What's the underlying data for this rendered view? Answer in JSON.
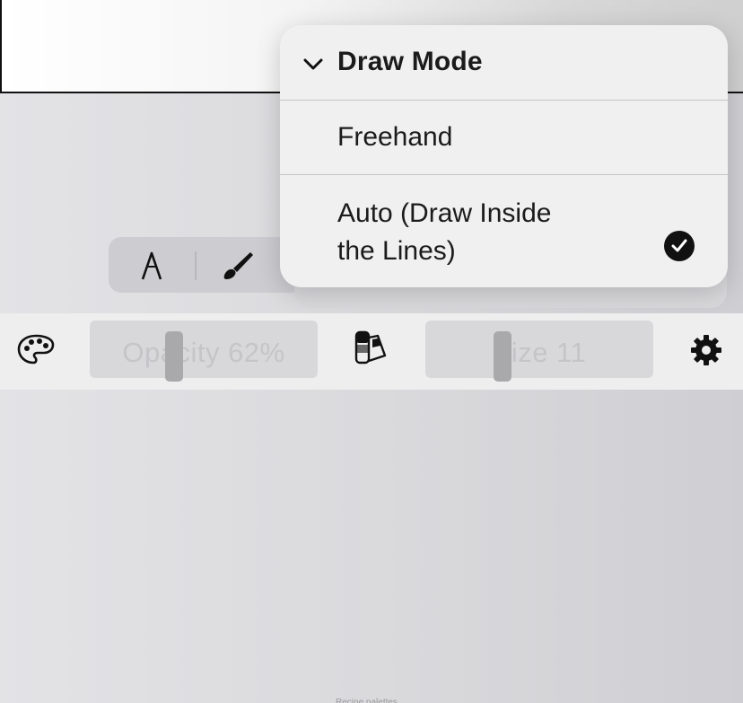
{
  "menu": {
    "title": "Draw Mode",
    "items": [
      {
        "label": "Freehand",
        "selected": false
      },
      {
        "label_line1": "Auto (Draw Inside",
        "label_line2": "the Lines)",
        "selected": true
      }
    ]
  },
  "tools": {
    "icons": [
      "pencil-tip-icon",
      "brush-icon"
    ]
  },
  "bottom_bar": {
    "palette_icon": "palette-icon",
    "opacity_label": "Opacity 62%",
    "opacity_value": 62,
    "swatches_icon": "color-swatches-icon",
    "swatches_caption": "Recipe palettes",
    "size_label": "Size 11",
    "size_value": 11,
    "settings_icon": "gear-icon"
  },
  "colors": {
    "menu_bg": "#f0f0f0",
    "text": "#1b1b1b",
    "check": "#111111",
    "bar_bg": "#eeeeef",
    "slider_bg": "#d8d8da"
  }
}
